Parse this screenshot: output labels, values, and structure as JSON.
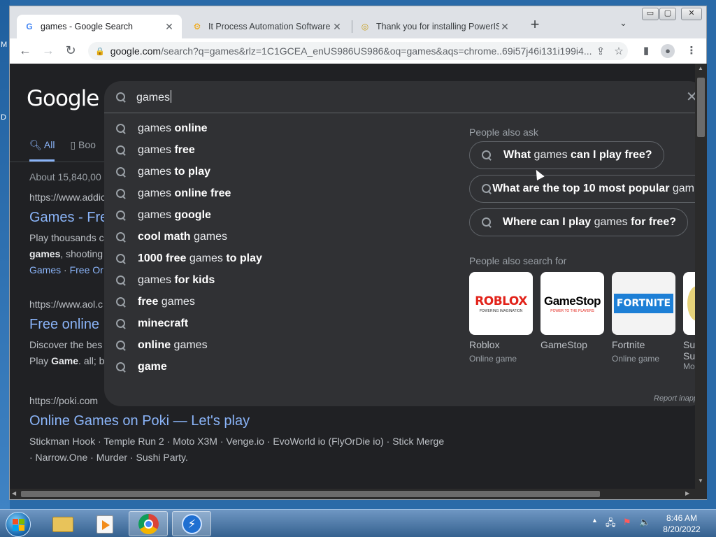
{
  "desktop": {
    "marks": [
      "M",
      "D"
    ]
  },
  "window": {
    "minimize": "▭",
    "maximize": "▢",
    "close": "✕"
  },
  "tabs": [
    {
      "title": "games - Google Search",
      "active": true,
      "icon": "google-icon"
    },
    {
      "title": "It Process Automation Software -",
      "active": false,
      "icon": "powershell-icon"
    },
    {
      "title": "Thank you for installing PowerISO",
      "active": false,
      "icon": "poweriso-icon"
    }
  ],
  "toolbar": {
    "back": "←",
    "forward": "→",
    "reload": "↻",
    "url_host": "google.com",
    "url_path": "/search?q=games&rlz=1C1GCEA_enUS986US986&oq=games&aqs=chrome..69i57j46i131i199i4..."
  },
  "page": {
    "logo": "Google",
    "tabs": [
      {
        "label": "All"
      },
      {
        "label": "Boo"
      }
    ],
    "stats": "About 15,840,00",
    "results": [
      {
        "url": "https://www.addic",
        "title": "Games - Fre",
        "snippet1": "Play thousands c",
        "snippet2_bold": "games",
        "snippet2": ", shooting",
        "links": [
          "Games",
          "Free Or"
        ]
      },
      {
        "url": "https://www.aol.c",
        "title": "Free online",
        "snippet1": "Discover the bes",
        "snippet2_pre": "Play ",
        "snippet2_bold": "Game",
        "snippet2": ". all; b"
      },
      {
        "url": "https://poki.com",
        "title": "Online Games on Poki — Let's play",
        "snippet1": "Stickman Hook · Temple Run 2 · Moto X3M · Venge.io · EvoWorld io (FlyOrDie io) · Stick Merge",
        "snippet2": "· Narrow.One · Murder · Sushi Party."
      }
    ]
  },
  "search": {
    "query": "games",
    "suggestions": [
      {
        "pre": "games ",
        "bold": "online"
      },
      {
        "pre": "games ",
        "bold": "free"
      },
      {
        "pre": "games ",
        "bold": "to play"
      },
      {
        "pre": "games ",
        "bold": "online free"
      },
      {
        "pre": "games ",
        "bold": "google"
      },
      {
        "pre": "",
        "bold": "cool math",
        "post": " games"
      },
      {
        "pre": "",
        "bold": "1000 free",
        "mid": " games ",
        "bold2": "to play"
      },
      {
        "pre": "games ",
        "bold": "for kids"
      },
      {
        "pre": "",
        "bold": "free",
        "post": " games"
      },
      {
        "pre": "",
        "bold": "minecraft"
      },
      {
        "pre": "",
        "bold": "online",
        "post": " games"
      },
      {
        "pre": "",
        "bold": "game"
      }
    ],
    "people_also_ask_heading": "People also ask",
    "people_also_ask": [
      {
        "b1": "What",
        "mid": " games ",
        "b2": "can I play free?"
      },
      {
        "b1": "What are the top 10 most popular",
        "mid": " gam",
        "b2": ""
      },
      {
        "b1": "Where can I play",
        "mid": " games ",
        "b2": "for free?"
      }
    ],
    "people_also_search_heading": "People also search for",
    "cards": [
      {
        "name": "Roblox",
        "sub": "Online game",
        "logo": "ROBLOX",
        "tag": "POWERING IMAGINATION"
      },
      {
        "name": "GameStop",
        "sub": "",
        "logo": "GameStop",
        "tag": "POWER TO THE PLAYERS"
      },
      {
        "name": "Fortnite",
        "sub": "Online game",
        "logo": "FORTNITE"
      },
      {
        "name": "Su",
        "sub2": "Su",
        "sub": "Mo"
      }
    ],
    "report": "Report inapp"
  },
  "taskbar": {
    "time": "8:46 AM",
    "date": "8/20/2022"
  }
}
